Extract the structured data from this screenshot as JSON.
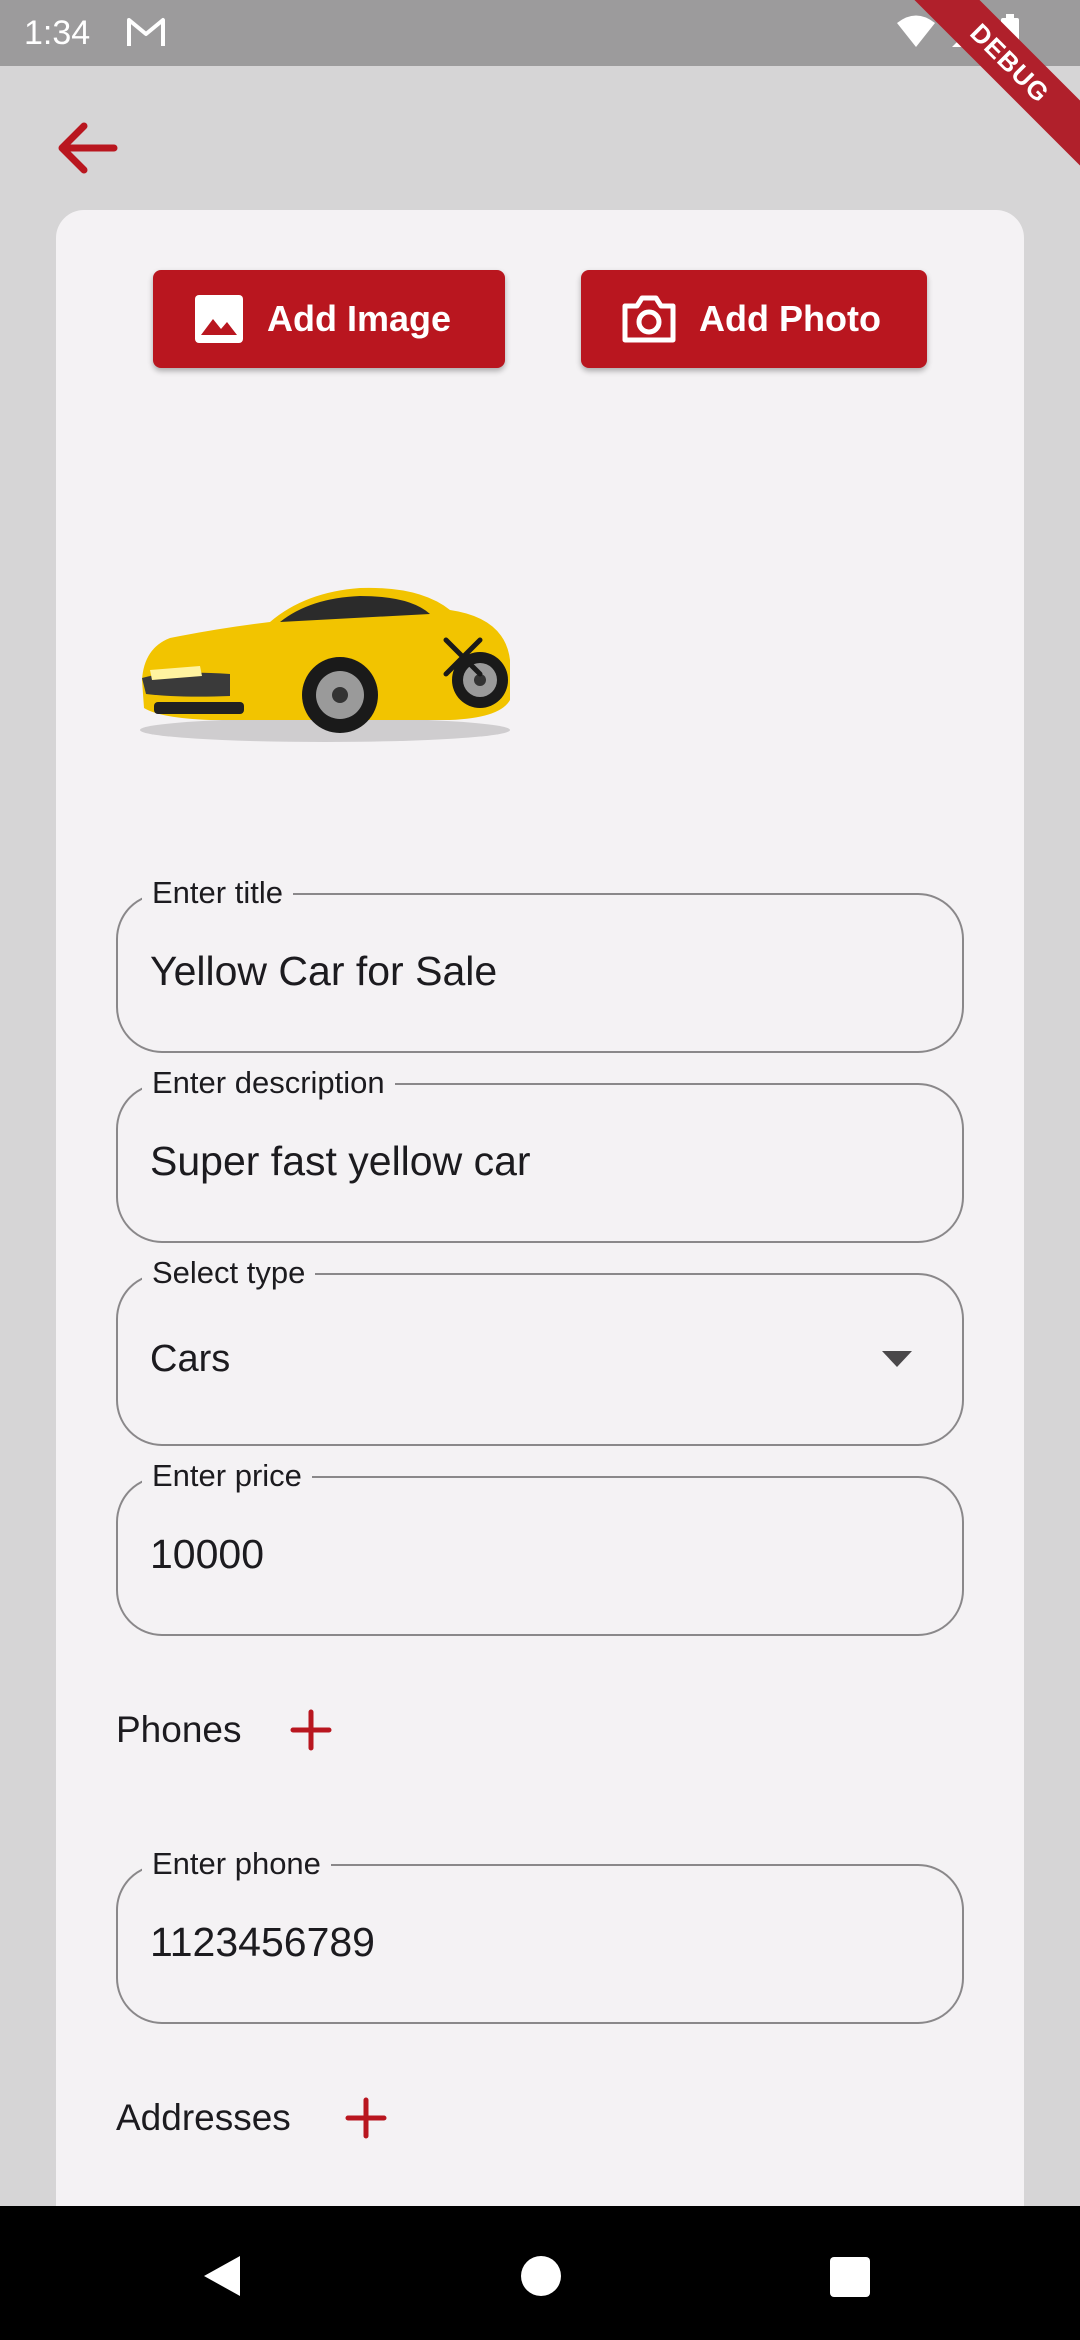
{
  "status_bar": {
    "time": "1:34",
    "debug_label": "DEBUG"
  },
  "header": {
    "back_icon": "arrow-left-icon"
  },
  "actions": {
    "add_image_label": "Add Image",
    "add_photo_label": "Add Photo"
  },
  "image_preview": {
    "remove_icon": "close-icon"
  },
  "form": {
    "title": {
      "label": "Enter title",
      "value": "Yellow Car for Sale"
    },
    "description": {
      "label": "Enter description",
      "value": "Super fast yellow car"
    },
    "type": {
      "label": "Select type",
      "value": "Cars"
    },
    "price": {
      "label": "Enter price",
      "value": "10000"
    },
    "phones_label": "Phones",
    "phone": {
      "label": "Enter phone",
      "value": "1123456789"
    },
    "addresses_label": "Addresses"
  },
  "colors": {
    "accent": "#b9161f",
    "background": "#d6d5d6",
    "card": "#f4f2f4"
  }
}
